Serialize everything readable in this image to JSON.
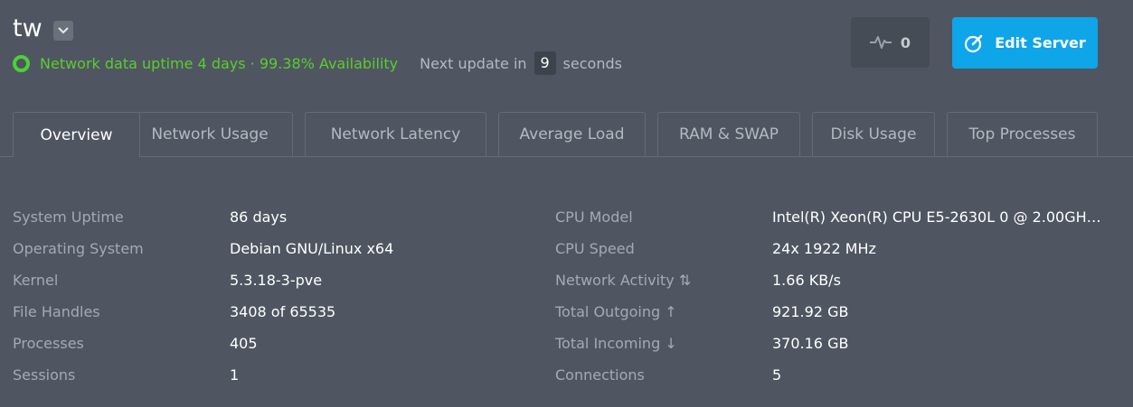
{
  "header": {
    "server_name": "tw",
    "status_text": "Network data uptime 4 days · 99.38% Availability",
    "next_update_prefix": "Next update in",
    "next_update_value": "9",
    "next_update_suffix": "seconds",
    "status_color": "#4cd137"
  },
  "actions": {
    "pulse_count": "0",
    "edit_label": "Edit Server",
    "edit_color": "#0fa5e9"
  },
  "tabs": [
    {
      "label": "Overview",
      "active": true
    },
    {
      "label": "Network Usage",
      "active": false
    },
    {
      "label": "Network Latency",
      "active": false
    },
    {
      "label": "Average Load",
      "active": false
    },
    {
      "label": "RAM & SWAP",
      "active": false
    },
    {
      "label": "Disk Usage",
      "active": false
    },
    {
      "label": "Top Processes",
      "active": false
    }
  ],
  "overview": {
    "left": [
      {
        "label": "System Uptime",
        "value": "86 days"
      },
      {
        "label": "Operating System",
        "value": "Debian GNU/Linux x64"
      },
      {
        "label": "Kernel",
        "value": "5.3.18-3-pve"
      },
      {
        "label": "File Handles",
        "value": "3408 of 65535"
      },
      {
        "label": "Processes",
        "value": "405"
      },
      {
        "label": "Sessions",
        "value": "1"
      }
    ],
    "right": [
      {
        "label": "CPU Model",
        "value": "Intel(R) Xeon(R) CPU E5-2630L 0 @ 2.00GH…"
      },
      {
        "label": "CPU Speed",
        "value": "24x 1922 MHz"
      },
      {
        "label": "Network Activity",
        "arrow": "⇅",
        "value": "1.66 KB/s"
      },
      {
        "label": "Total Outgoing",
        "arrow": "↑",
        "value": "921.92 GB"
      },
      {
        "label": "Total Incoming",
        "arrow": "↓",
        "value": "370.16 GB"
      },
      {
        "label": "Connections",
        "value": "5"
      }
    ]
  }
}
